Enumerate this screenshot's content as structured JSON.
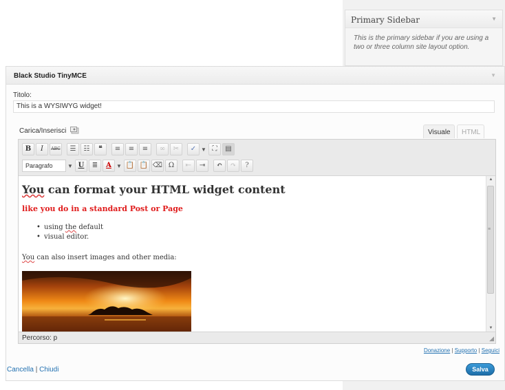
{
  "primary_sidebar": {
    "title": "Primary Sidebar",
    "description": "This is the primary sidebar if you are using a two or three column site layout option."
  },
  "widget": {
    "title": "Black Studio TinyMCE",
    "title_label": "Titolo:",
    "title_value": "This is a WYSIWYG widget!",
    "media_label": "Carica/Inserisci",
    "tabs": {
      "visual": "Visuale",
      "html": "HTML"
    },
    "toolbar": {
      "bold": "B",
      "italic": "I",
      "strike": "ABC",
      "format_select": "Paragrafo",
      "underline": "U",
      "text_color": "A",
      "omega": "Ω"
    },
    "content": {
      "heading": "You can format your HTML widget content",
      "subheading": "like you do in a standard Post or Page",
      "bullets": [
        "using the default",
        "visual editor."
      ],
      "paragraph": "You can also insert images and other media:"
    },
    "status_label": "Percorso:",
    "status_value": "p",
    "footer_links": {
      "donate": "Donazione",
      "support": "Supporto",
      "follow": "Seguici"
    },
    "cancel": "Cancella",
    "close": "Chiudi",
    "save": "Salva"
  },
  "colors": {
    "link": "#2271b1",
    "subheading": "#e01b1b",
    "save_button": "#2a86c4"
  }
}
